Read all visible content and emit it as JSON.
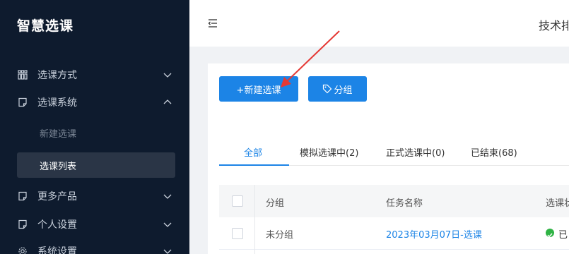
{
  "sidebar": {
    "brand": "智慧选课",
    "menu": [
      {
        "label": "选课方式",
        "icon": "grid-icon",
        "expanded": false
      },
      {
        "label": "选课系统",
        "icon": "doc-icon",
        "expanded": true
      },
      {
        "label": "更多产品",
        "icon": "doc-icon",
        "expanded": false
      },
      {
        "label": "个人设置",
        "icon": "doc-icon",
        "expanded": false
      },
      {
        "label": "系统设置",
        "icon": "gear-icon",
        "expanded": false
      }
    ],
    "submenu": [
      {
        "label": "新建选课",
        "active": false
      },
      {
        "label": "选课列表",
        "active": true
      }
    ]
  },
  "header": {
    "user_text": "技术排"
  },
  "toolbar": {
    "new_label": "+新建选课",
    "group_label": "分组"
  },
  "tabs": [
    {
      "label": "全部",
      "active": true
    },
    {
      "label": "模拟选课中(2)",
      "active": false
    },
    {
      "label": "正式选课中(0)",
      "active": false
    },
    {
      "label": "已结束(68)",
      "active": false
    }
  ],
  "table": {
    "columns": [
      "分组",
      "任务名称",
      "选课状"
    ],
    "rows": [
      {
        "group": "未分组",
        "task": "2023年03月07日-选课",
        "status": "已"
      }
    ]
  },
  "colors": {
    "sidebar_bg": "#0e1b2e",
    "accent": "#1c84e6",
    "annotation_arrow": "#e53935",
    "status_green": "#2fb344"
  }
}
